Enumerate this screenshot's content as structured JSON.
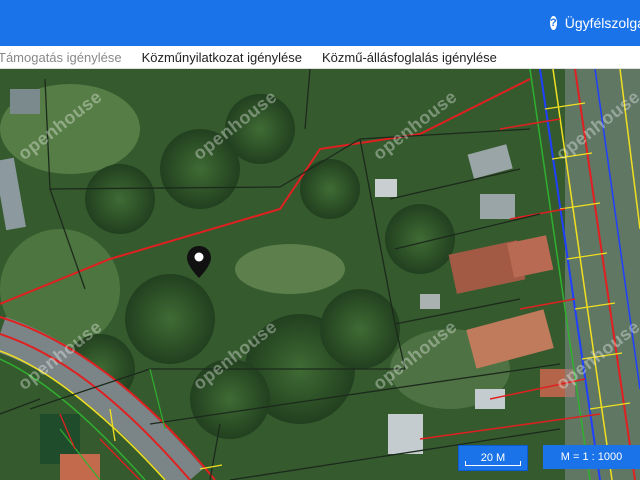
{
  "header": {
    "help_label": "Ügyfélszolgálat",
    "help_icon": "question-circle-icon"
  },
  "tabs": [
    {
      "label": "Támogatás igénylése"
    },
    {
      "label": "Közműnyilatkozat igénylése"
    },
    {
      "label": "Közmű-állásfoglalás igénylése"
    }
  ],
  "map": {
    "scale_bar_label": "20 M",
    "scale_ratio_label": "M = 1 : 1000",
    "watermark_text": "openhouse",
    "marker_icon": "map-pin-icon"
  },
  "colors": {
    "header_bg": "#1a73e8",
    "parcel_line": "#1f2a1f",
    "utility_red": "#e02020",
    "utility_yellow": "#f0e020",
    "utility_blue": "#2040ff",
    "utility_green": "#30b030"
  }
}
